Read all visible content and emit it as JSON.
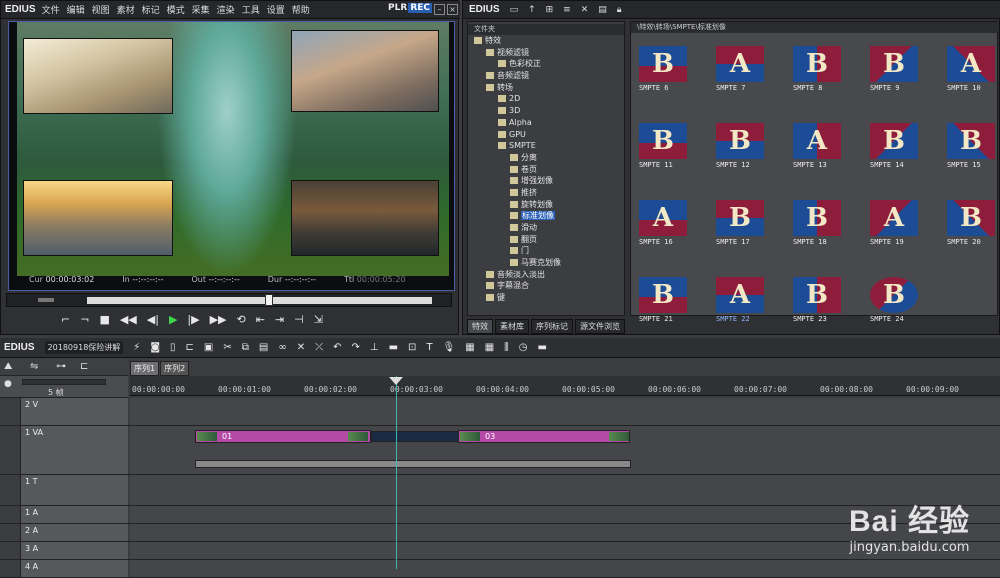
{
  "player": {
    "menu": {
      "logo": "EDIUS",
      "items": [
        "文件",
        "编辑",
        "视图",
        "素材",
        "标记",
        "模式",
        "采集",
        "渲染",
        "工具",
        "设置",
        "帮助"
      ],
      "plr": "PLR",
      "rec": "REC"
    },
    "timecodes": {
      "cur_label": "Cur",
      "cur": "00:00:03:02",
      "in_label": "In",
      "in": "--:--:--:--",
      "out_label": "Out",
      "out": "--:--:--:--",
      "dur_label": "Dur",
      "dur": "--:--:--:--",
      "ttl_label": "Ttl",
      "ttl": "00:00:05:20"
    }
  },
  "library": {
    "logo": "EDIUS",
    "tree_header": "文件夹",
    "path": "\\特效\\转场\\SMPTE\\标准划像",
    "tree": [
      {
        "label": "特效",
        "indent": 0
      },
      {
        "label": "视频滤镜",
        "indent": 1
      },
      {
        "label": "色彩校正",
        "indent": 2
      },
      {
        "label": "音频滤镜",
        "indent": 1
      },
      {
        "label": "转场",
        "indent": 1
      },
      {
        "label": "2D",
        "indent": 2
      },
      {
        "label": "3D",
        "indent": 2
      },
      {
        "label": "Alpha",
        "indent": 2
      },
      {
        "label": "GPU",
        "indent": 2
      },
      {
        "label": "SMPTE",
        "indent": 2
      },
      {
        "label": "分离",
        "indent": 3
      },
      {
        "label": "卷页",
        "indent": 3
      },
      {
        "label": "增强划像",
        "indent": 3
      },
      {
        "label": "推挤",
        "indent": 3
      },
      {
        "label": "旋转划像",
        "indent": 3
      },
      {
        "label": "标准划像",
        "indent": 3,
        "selected": true
      },
      {
        "label": "滑动",
        "indent": 3
      },
      {
        "label": "翻页",
        "indent": 3
      },
      {
        "label": "门",
        "indent": 3
      },
      {
        "label": "马赛克划像",
        "indent": 3
      },
      {
        "label": "音频淡入淡出",
        "indent": 1
      },
      {
        "label": "字幕混合",
        "indent": 1
      },
      {
        "label": "键",
        "indent": 1
      }
    ],
    "tabs": [
      "特效",
      "素材库",
      "序列标记",
      "源文件浏览"
    ],
    "thumbs": [
      {
        "label": "SMPTE   6"
      },
      {
        "label": "SMPTE   7"
      },
      {
        "label": "SMPTE   8"
      },
      {
        "label": "SMPTE   9"
      },
      {
        "label": "SMPTE   10"
      },
      {
        "label": "SMPTE   11"
      },
      {
        "label": "SMPTE   12"
      },
      {
        "label": "SMPTE   13"
      },
      {
        "label": "SMPTE   14"
      },
      {
        "label": "SMPTE   15"
      },
      {
        "label": "SMPTE   16"
      },
      {
        "label": "SMPTE   17"
      },
      {
        "label": "SMPTE   18"
      },
      {
        "label": "SMPTE   19"
      },
      {
        "label": "SMPTE   20"
      },
      {
        "label": "SMPTE   21"
      },
      {
        "label": "SMPTE   22",
        "selected": true
      },
      {
        "label": "SMPTE   23"
      },
      {
        "label": "SMPTE   24"
      }
    ],
    "colors": {
      "blue": "#1c4c96",
      "red": "#8d1d3b",
      "letter": "#f3e8c6"
    }
  },
  "timeline": {
    "logo": "EDIUS",
    "project": "20180918保险讲解",
    "zoom": "5 帧",
    "seq_tabs": [
      "序列1",
      "序列2"
    ],
    "ruler": [
      "00:00:00:00",
      "00:00:01:00",
      "00:00:02:00",
      "00:00:03:00",
      "00:00:04:00",
      "00:00:05:00",
      "00:00:06:00",
      "00:00:07:00",
      "00:00:08:00",
      "00:00:09:00"
    ],
    "tracks": [
      {
        "name": "2 V"
      },
      {
        "name": "1 VA"
      },
      {
        "name": "1 T"
      },
      {
        "name": "1 A"
      },
      {
        "name": "2 A"
      },
      {
        "name": "3 A"
      },
      {
        "name": "4 A"
      }
    ],
    "clips": {
      "clip1": "01",
      "clip2": "03"
    }
  },
  "watermark": {
    "big": "Bai 经验",
    "small": "jingyan.baidu.com"
  }
}
